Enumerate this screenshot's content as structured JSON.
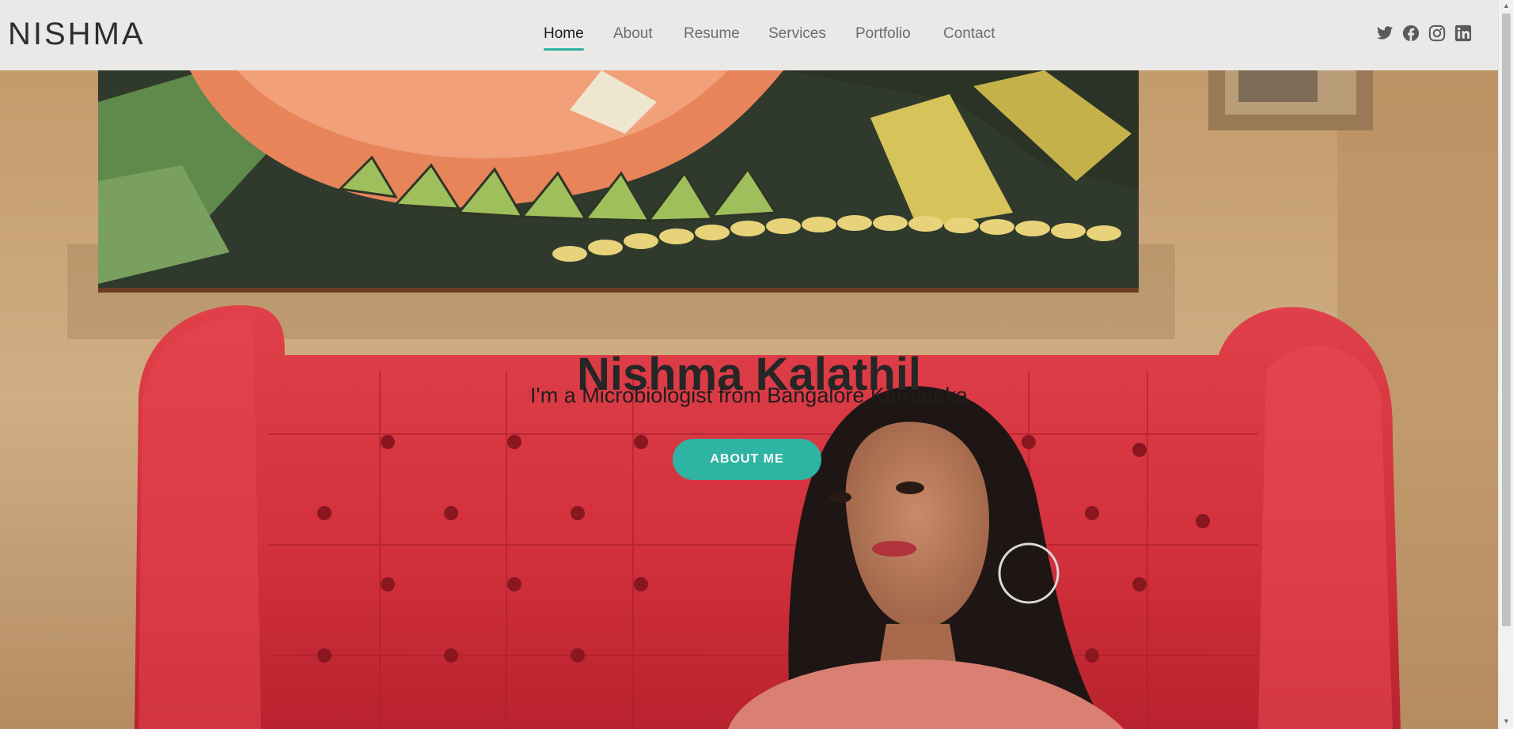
{
  "site": {
    "logo": "NISHMA"
  },
  "nav": {
    "items": [
      {
        "label": "Home",
        "active": true
      },
      {
        "label": "About",
        "active": false
      },
      {
        "label": "Resume",
        "active": false
      },
      {
        "label": "Services",
        "active": false
      },
      {
        "label": "Portfolio",
        "active": false
      },
      {
        "label": "Contact",
        "active": false
      }
    ]
  },
  "social": {
    "icons": [
      "twitter-icon",
      "facebook-icon",
      "instagram-icon",
      "linkedin-icon"
    ]
  },
  "hero": {
    "title": "Nishma Kalathil",
    "subtitle": "I'm a Microbiologist from Bangalore Karnataka",
    "button_label": "ABOUT ME"
  },
  "colors": {
    "accent": "#2fb3a3",
    "header_bg": "#eae9e7",
    "text_dark": "#262626",
    "nav_text": "#6d6d6d"
  }
}
